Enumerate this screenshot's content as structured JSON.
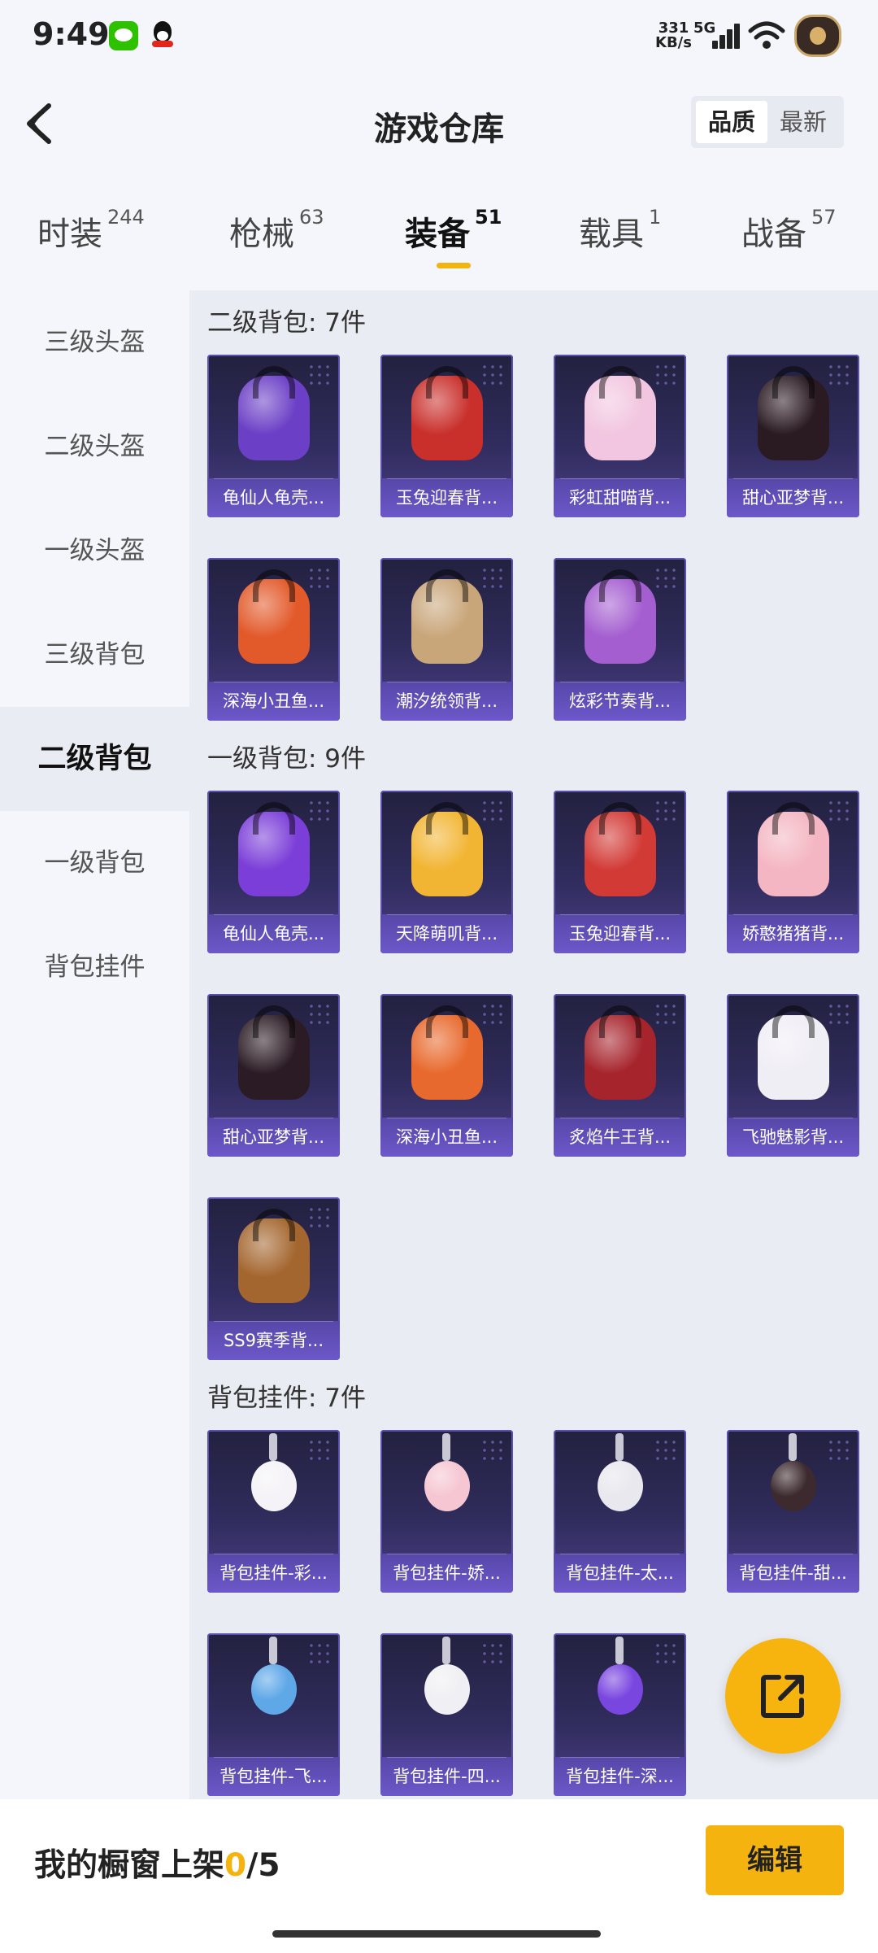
{
  "status_bar": {
    "time": "9:49",
    "speed_value": "331",
    "speed_unit": "KB/s",
    "network": "5G"
  },
  "header": {
    "title": "游戏仓库",
    "sort_options": [
      "品质",
      "最新"
    ],
    "selected_sort": "品质"
  },
  "tabs": [
    {
      "label": "时装",
      "count": "244"
    },
    {
      "label": "枪械",
      "count": "63"
    },
    {
      "label": "装备",
      "count": "51"
    },
    {
      "label": "载具",
      "count": "1"
    },
    {
      "label": "战备",
      "count": "57"
    }
  ],
  "active_tab": "装备",
  "sidebar": {
    "items": [
      "三级头盔",
      "二级头盔",
      "一级头盔",
      "三级背包",
      "二级背包",
      "一级背包",
      "背包挂件"
    ],
    "active": "二级背包"
  },
  "sections": [
    {
      "title": "二级背包: 7件",
      "items": [
        {
          "name": "龟仙人龟壳...",
          "color": "#6b3fc6"
        },
        {
          "name": "玉兔迎春背...",
          "color": "#c9302c"
        },
        {
          "name": "彩虹甜喵背...",
          "color": "#f2c6e0"
        },
        {
          "name": "甜心亚梦背...",
          "color": "#2a1a22"
        },
        {
          "name": "深海小丑鱼...",
          "color": "#e2592a"
        },
        {
          "name": "潮汐统领背...",
          "color": "#c9a67a"
        },
        {
          "name": "炫彩节奏背...",
          "color": "#a45ed0"
        }
      ]
    },
    {
      "title": "一级背包: 9件",
      "items": [
        {
          "name": "龟仙人龟壳...",
          "color": "#7b3ed8"
        },
        {
          "name": "天降萌叽背...",
          "color": "#f2b533"
        },
        {
          "name": "玉兔迎春背...",
          "color": "#d23a36"
        },
        {
          "name": "娇憨猪猪背...",
          "color": "#f4b6c2"
        },
        {
          "name": "甜心亚梦背...",
          "color": "#2b1b24"
        },
        {
          "name": "深海小丑鱼...",
          "color": "#e8692d"
        },
        {
          "name": "炙焰牛王背...",
          "color": "#a6242c"
        },
        {
          "name": "飞驰魅影背...",
          "color": "#f0eef5"
        },
        {
          "name": "SS9赛季背...",
          "color": "#a4662f"
        }
      ]
    },
    {
      "title": "背包挂件: 7件",
      "items": [
        {
          "name": "背包挂件-彩...",
          "color": "#f5f3f7"
        },
        {
          "name": "背包挂件-娇...",
          "color": "#f6c7d3"
        },
        {
          "name": "背包挂件-太...",
          "color": "#e8e8ee"
        },
        {
          "name": "背包挂件-甜...",
          "color": "#3c2a2e"
        },
        {
          "name": "背包挂件-飞...",
          "color": "#5fa8e8"
        },
        {
          "name": "背包挂件-四...",
          "color": "#f0f0f4"
        },
        {
          "name": "背包挂件-深...",
          "color": "#7a46e0"
        }
      ]
    }
  ],
  "showcase": {
    "label": "我的橱窗上架",
    "current": "0",
    "total": "/5",
    "edit_label": "编辑"
  }
}
